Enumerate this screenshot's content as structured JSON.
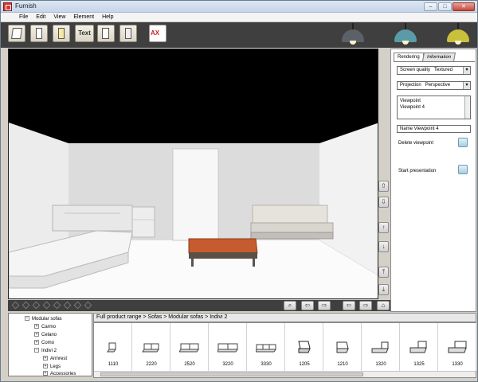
{
  "window": {
    "title": "Furnish"
  },
  "menu": {
    "items": [
      "File",
      "Edit",
      "View",
      "Element",
      "Help"
    ]
  },
  "toolbar": {
    "text_button_label": "Text",
    "ax_label": "AX",
    "lamp_colors": [
      "#5b6168",
      "#5b9aa7",
      "#c9c13c"
    ]
  },
  "panel": {
    "tabs": [
      "Rendering",
      "Information"
    ],
    "screen_quality": {
      "label": "Screen quality",
      "value": "Textured"
    },
    "projection": {
      "label": "Projection",
      "value": "Perspective"
    },
    "viewpoint_list": [
      "Viewpoint",
      "Viewpoint 4"
    ],
    "name_field": "Name Viewpoint 4",
    "delete_viewpoint": "Delete viewpoint",
    "start_presentation": "Start presentation"
  },
  "tree": {
    "items": [
      {
        "label": "Modular sofas",
        "level": 1,
        "expander": "−"
      },
      {
        "label": "Carmo",
        "level": 2,
        "expander": "+"
      },
      {
        "label": "Celano",
        "level": 2,
        "expander": "+"
      },
      {
        "label": "Como",
        "level": 2,
        "expander": "+"
      },
      {
        "label": "Indivi 2",
        "level": 2,
        "expander": "−"
      },
      {
        "label": "Armrest",
        "level": 3,
        "expander": "+"
      },
      {
        "label": "Legs",
        "level": 3,
        "expander": "+"
      },
      {
        "label": "Accessories",
        "level": 3,
        "expander": "+"
      }
    ]
  },
  "breadcrumb": "Full product range > Sofas > Modular sofas > Indivi 2",
  "products": [
    "1110",
    "2220",
    "2520",
    "3220",
    "3330",
    "1205",
    "1210",
    "1320",
    "1325",
    "1330"
  ]
}
